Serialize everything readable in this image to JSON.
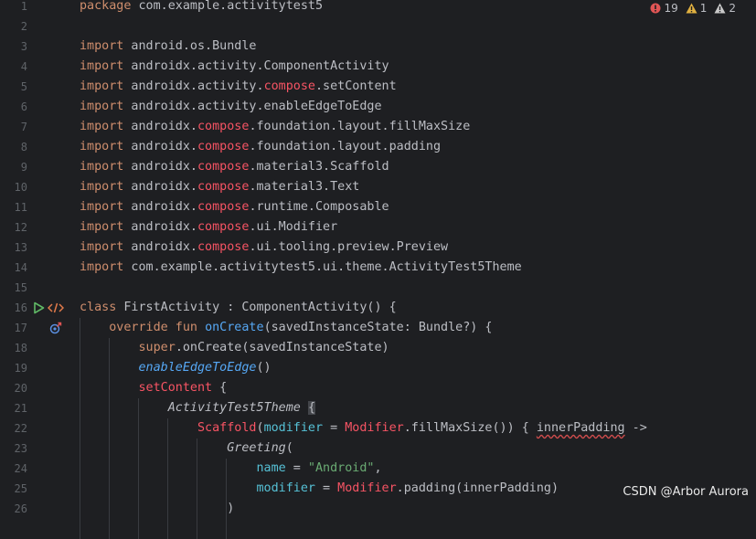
{
  "colors": {
    "background": "#1e1f22",
    "keyword": "#cf8e6d",
    "compose": "#f75464",
    "function": "#56a8f5",
    "parameter": "#56c1d6",
    "string": "#6aab73",
    "line_number": "#5f6368",
    "error": "#e05555",
    "warning": "#e0b040"
  },
  "inspections": {
    "errors": "19",
    "warnings": "1",
    "weak_warnings": "2",
    "error_icon": "error-circle-icon",
    "warning_icon": "warning-triangle-icon",
    "weak_warning_icon": "weak-warning-triangle-icon"
  },
  "gutter": {
    "line16_icons": [
      "run-icon",
      "compose-preview-icon"
    ],
    "line17_icons": [
      "override-icon"
    ]
  },
  "watermark": "CSDN @Arbor Aurora",
  "lines": [
    {
      "num": "1",
      "tokens": [
        {
          "t": "package",
          "c": "kw"
        },
        {
          "t": " com.example.activitytest5",
          "c": "pkg"
        }
      ]
    },
    {
      "num": "2",
      "tokens": []
    },
    {
      "num": "3",
      "tokens": [
        {
          "t": "import",
          "c": "kw"
        },
        {
          "t": " android.os.Bundle",
          "c": "pkg"
        }
      ]
    },
    {
      "num": "4",
      "tokens": [
        {
          "t": "import",
          "c": "kw"
        },
        {
          "t": " androidx.activity.ComponentActivity",
          "c": "pkg"
        }
      ]
    },
    {
      "num": "5",
      "tokens": [
        {
          "t": "import",
          "c": "kw"
        },
        {
          "t": " androidx.activity.",
          "c": "pkg"
        },
        {
          "t": "compose",
          "c": "comp"
        },
        {
          "t": ".setContent",
          "c": "pkg"
        }
      ]
    },
    {
      "num": "6",
      "tokens": [
        {
          "t": "import",
          "c": "kw"
        },
        {
          "t": " androidx.activity.enableEdgeToEdge",
          "c": "pkg"
        }
      ]
    },
    {
      "num": "7",
      "tokens": [
        {
          "t": "import",
          "c": "kw"
        },
        {
          "t": " androidx.",
          "c": "pkg"
        },
        {
          "t": "compose",
          "c": "comp"
        },
        {
          "t": ".foundation.layout.fillMaxSize",
          "c": "pkg"
        }
      ]
    },
    {
      "num": "8",
      "tokens": [
        {
          "t": "import",
          "c": "kw"
        },
        {
          "t": " androidx.",
          "c": "pkg"
        },
        {
          "t": "compose",
          "c": "comp"
        },
        {
          "t": ".foundation.layout.padding",
          "c": "pkg"
        }
      ]
    },
    {
      "num": "9",
      "tokens": [
        {
          "t": "import",
          "c": "kw"
        },
        {
          "t": " androidx.",
          "c": "pkg"
        },
        {
          "t": "compose",
          "c": "comp"
        },
        {
          "t": ".material3.Scaffold",
          "c": "pkg"
        }
      ]
    },
    {
      "num": "10",
      "tokens": [
        {
          "t": "import",
          "c": "kw"
        },
        {
          "t": " androidx.",
          "c": "pkg"
        },
        {
          "t": "compose",
          "c": "comp"
        },
        {
          "t": ".material3.Text",
          "c": "pkg"
        }
      ]
    },
    {
      "num": "11",
      "tokens": [
        {
          "t": "import",
          "c": "kw"
        },
        {
          "t": " androidx.",
          "c": "pkg"
        },
        {
          "t": "compose",
          "c": "comp"
        },
        {
          "t": ".runtime.Composable",
          "c": "pkg"
        }
      ]
    },
    {
      "num": "12",
      "tokens": [
        {
          "t": "import",
          "c": "kw"
        },
        {
          "t": " androidx.",
          "c": "pkg"
        },
        {
          "t": "compose",
          "c": "comp"
        },
        {
          "t": ".ui.Modifier",
          "c": "pkg"
        }
      ]
    },
    {
      "num": "13",
      "tokens": [
        {
          "t": "import",
          "c": "kw"
        },
        {
          "t": " androidx.",
          "c": "pkg"
        },
        {
          "t": "compose",
          "c": "comp"
        },
        {
          "t": ".ui.tooling.preview.Preview",
          "c": "pkg"
        }
      ]
    },
    {
      "num": "14",
      "tokens": [
        {
          "t": "import",
          "c": "kw"
        },
        {
          "t": " com.example.activitytest5.ui.theme.ActivityTest5Theme",
          "c": "pkg"
        }
      ]
    },
    {
      "num": "15",
      "tokens": []
    },
    {
      "num": "16",
      "tokens": [
        {
          "t": "class",
          "c": "kw"
        },
        {
          "t": " FirstActivity : ComponentActivity() {",
          "c": "pkg"
        }
      ]
    },
    {
      "num": "17",
      "tokens": [
        {
          "t": "    ",
          "c": "pkg"
        },
        {
          "t": "override fun",
          "c": "kw"
        },
        {
          "t": " ",
          "c": "pkg"
        },
        {
          "t": "onCreate",
          "c": "fn"
        },
        {
          "t": "(savedInstanceState: Bundle?) {",
          "c": "pkg"
        }
      ]
    },
    {
      "num": "18",
      "tokens": [
        {
          "t": "        ",
          "c": "pkg"
        },
        {
          "t": "super",
          "c": "kw"
        },
        {
          "t": ".onCreate(savedInstanceState)",
          "c": "pkg"
        }
      ]
    },
    {
      "num": "19",
      "tokens": [
        {
          "t": "        ",
          "c": "pkg"
        },
        {
          "t": "enableEdgeToEdge",
          "c": "it"
        },
        {
          "t": "()",
          "c": "pkg"
        }
      ]
    },
    {
      "num": "20",
      "tokens": [
        {
          "t": "        ",
          "c": "pkg"
        },
        {
          "t": "setContent",
          "c": "comp"
        },
        {
          "t": " {",
          "c": "pkg"
        }
      ]
    },
    {
      "num": "21",
      "tokens": [
        {
          "t": "            ",
          "c": "pkg"
        },
        {
          "t": "ActivityTest5Theme",
          "c": "itc"
        },
        {
          "t": " ",
          "c": "pkg"
        },
        {
          "t": "{",
          "c": "brace"
        }
      ]
    },
    {
      "num": "22",
      "tokens": [
        {
          "t": "                ",
          "c": "pkg"
        },
        {
          "t": "Scaffold",
          "c": "comp"
        },
        {
          "t": "(",
          "c": "pkg"
        },
        {
          "t": "modifier",
          "c": "param"
        },
        {
          "t": " = ",
          "c": "pkg"
        },
        {
          "t": "Modifier",
          "c": "comp"
        },
        {
          "t": ".fillMaxSize()) { ",
          "c": "pkg"
        },
        {
          "t": "innerPadding",
          "c": "sq"
        },
        {
          "t": " ->",
          "c": "pkg"
        }
      ]
    },
    {
      "num": "23",
      "tokens": [
        {
          "t": "                    ",
          "c": "pkg"
        },
        {
          "t": "Greeting",
          "c": "itc"
        },
        {
          "t": "(",
          "c": "pkg"
        }
      ]
    },
    {
      "num": "24",
      "tokens": [
        {
          "t": "                        ",
          "c": "pkg"
        },
        {
          "t": "name",
          "c": "param"
        },
        {
          "t": " = ",
          "c": "pkg"
        },
        {
          "t": "\"Android\"",
          "c": "str"
        },
        {
          "t": ",",
          "c": "pkg"
        }
      ]
    },
    {
      "num": "25",
      "tokens": [
        {
          "t": "                        ",
          "c": "pkg"
        },
        {
          "t": "modifier",
          "c": "param"
        },
        {
          "t": " = ",
          "c": "pkg"
        },
        {
          "t": "Modifier",
          "c": "comp"
        },
        {
          "t": ".padding(innerPadding)",
          "c": "pkg"
        }
      ]
    },
    {
      "num": "26",
      "tokens": [
        {
          "t": "                    )",
          "c": "pkg"
        }
      ]
    }
  ]
}
